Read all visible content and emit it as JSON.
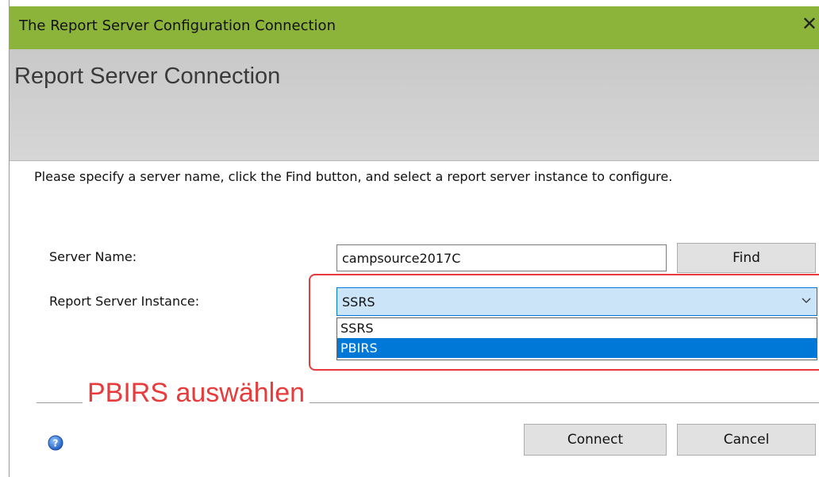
{
  "window": {
    "title": "The Report Server Configuration Connection",
    "close_glyph": "✕"
  },
  "banner": {
    "heading": "Report Server Connection"
  },
  "instructions": "Please specify a server name, click the Find button, and select a report server instance to configure.",
  "form": {
    "server_name_label": "Server Name:",
    "server_name_value": "campsource2017C",
    "find_label": "Find",
    "instance_label": "Report Server Instance:",
    "instance_selected": "SSRS",
    "instance_options": [
      "SSRS",
      "PBIRS"
    ],
    "highlighted_option": "PBIRS"
  },
  "annotation": {
    "text": "PBIRS auswählen",
    "color": "#e83b3b"
  },
  "footer": {
    "connect_label": "Connect",
    "cancel_label": "Cancel",
    "help_icon": "help-icon"
  },
  "colors": {
    "titlebar": "#8db43a",
    "selection": "#0078d7",
    "select_bg": "#cce4f7"
  }
}
